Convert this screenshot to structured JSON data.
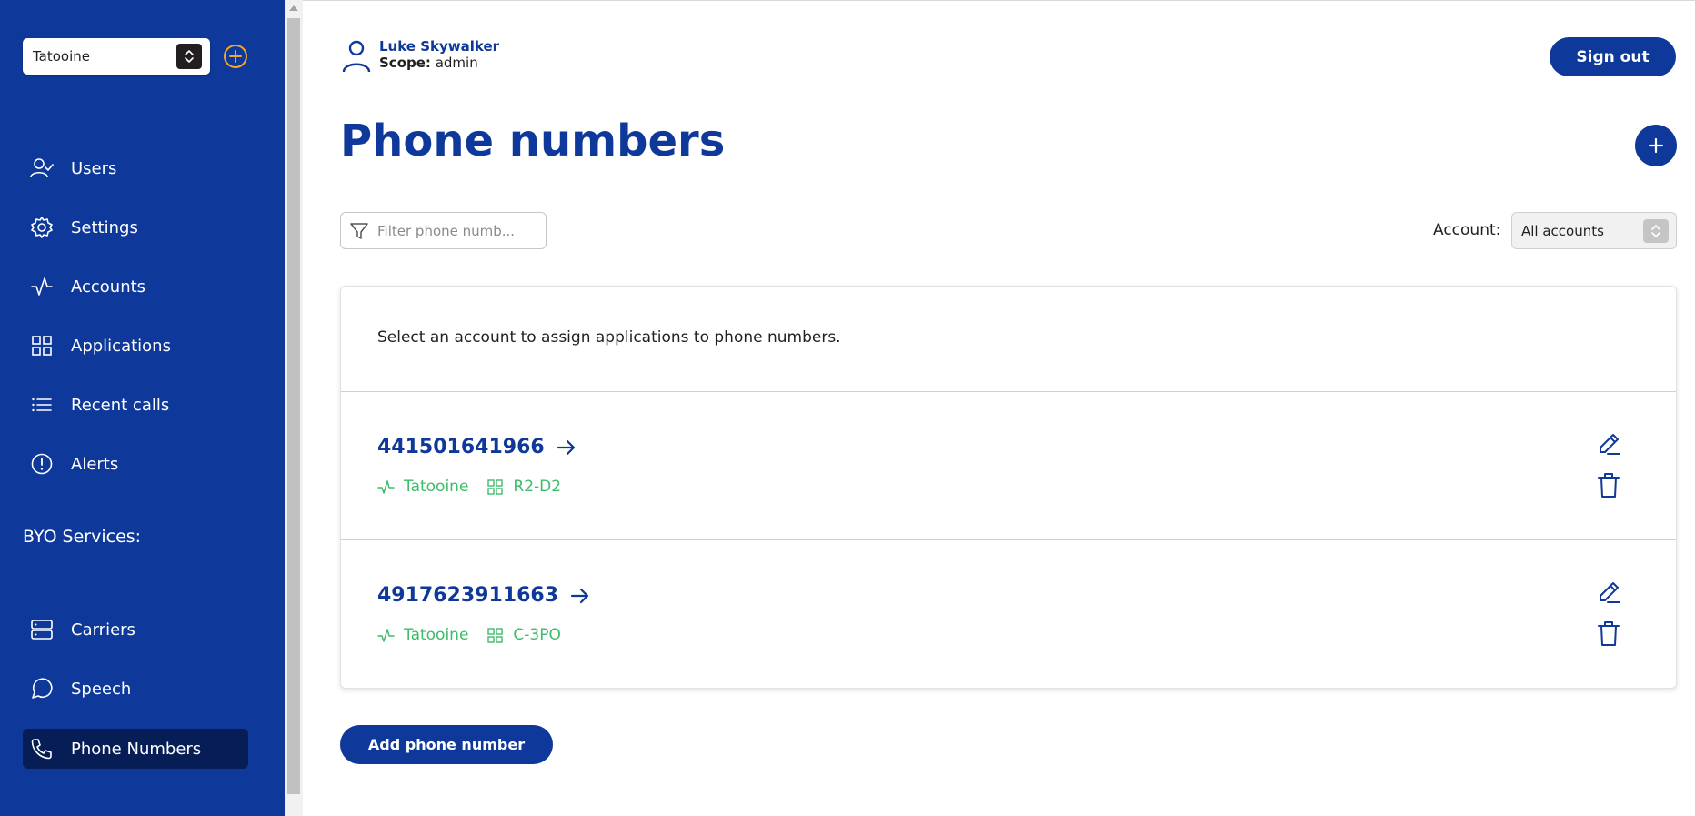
{
  "sidebar": {
    "service_provider": "Tatooine",
    "nav": [
      {
        "label": "Users",
        "icon": "user-check-icon"
      },
      {
        "label": "Settings",
        "icon": "gear-icon"
      },
      {
        "label": "Accounts",
        "icon": "activity-icon"
      },
      {
        "label": "Applications",
        "icon": "grid-icon"
      },
      {
        "label": "Recent calls",
        "icon": "list-icon"
      },
      {
        "label": "Alerts",
        "icon": "alert-circle-icon"
      }
    ],
    "byo_title": "BYO Services:",
    "byo_nav": [
      {
        "label": "Carriers",
        "icon": "server-icon"
      },
      {
        "label": "Speech",
        "icon": "message-circle-icon"
      },
      {
        "label": "Phone Numbers",
        "icon": "phone-icon",
        "active": true
      }
    ]
  },
  "header": {
    "user_name": "Luke Skywalker",
    "scope_label": "Scope:",
    "scope_value": "admin",
    "sign_out": "Sign out"
  },
  "page": {
    "title": "Phone numbers",
    "filter_placeholder": "Filter phone numb...",
    "account_label": "Account:",
    "account_value": "All accounts",
    "hint": "Select an account to assign applications to phone numbers.",
    "add_button": "Add phone number"
  },
  "phone_numbers": [
    {
      "number": "441501641966",
      "account": "Tatooine",
      "application": "R2-D2"
    },
    {
      "number": "4917623911663",
      "account": "Tatooine",
      "application": "C-3PO"
    }
  ],
  "colors": {
    "brand": "#0e3899",
    "sidebar_active": "#071d55",
    "accent_orange": "#f5a623",
    "status_green": "#3ebc6a"
  }
}
